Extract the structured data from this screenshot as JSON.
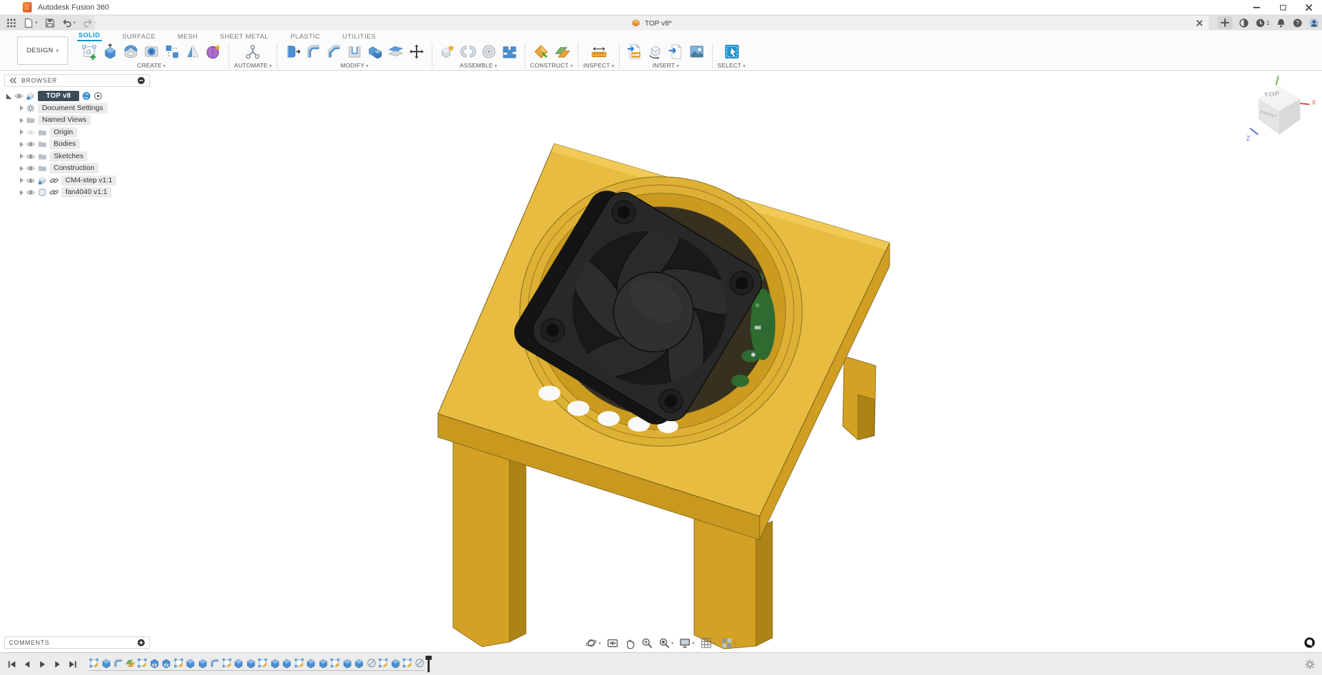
{
  "window": {
    "title": "Autodesk Fusion 360"
  },
  "qat": {
    "items": [
      {
        "name": "app-grid",
        "caret": false
      },
      {
        "name": "file-menu",
        "caret": true
      },
      {
        "name": "save",
        "caret": false
      },
      {
        "name": "undo",
        "caret": true
      },
      {
        "name": "redo",
        "caret": true,
        "disabled": true
      }
    ]
  },
  "tabstrip": {
    "active_tab": {
      "label": "TOP v8*"
    },
    "job_count": "1",
    "right_icons": [
      "extensions",
      "job-status",
      "notifications",
      "help",
      "profile"
    ]
  },
  "ribbon": {
    "design_label": "DESIGN",
    "active_tab": "SOLID",
    "tabs": [
      "SOLID",
      "SURFACE",
      "MESH",
      "SHEET METAL",
      "PLASTIC",
      "UTILITIES"
    ],
    "groups": [
      {
        "label": "CREATE",
        "icons": [
          "create-sketch",
          "extrude",
          "revolve",
          "hole",
          "pattern",
          "mirror",
          "form"
        ]
      },
      {
        "label": "AUTOMATE",
        "icons": [
          "automate"
        ]
      },
      {
        "label": "MODIFY",
        "icons": [
          "press-pull",
          "fillet",
          "chamfer",
          "shell",
          "combine",
          "split",
          "move"
        ]
      },
      {
        "label": "ASSEMBLE",
        "icons": [
          "new-component",
          "joint",
          "as-built-joint",
          "rigid-group"
        ]
      },
      {
        "label": "CONSTRUCT",
        "icons": [
          "plane",
          "offset-plane"
        ]
      },
      {
        "label": "INSPECT",
        "icons": [
          "measure"
        ]
      },
      {
        "label": "INSERT",
        "icons": [
          "insert-svg",
          "insert-mesh",
          "derive",
          "canvas"
        ]
      },
      {
        "label": "SELECT",
        "icons": [
          "select"
        ]
      }
    ]
  },
  "browser": {
    "header": "BROWSER",
    "root": {
      "label": "TOP v8"
    },
    "items": [
      {
        "label": "Document Settings",
        "icon": "gear",
        "eye": "none",
        "link": false
      },
      {
        "label": "Named Views",
        "icon": "folder",
        "eye": "none",
        "link": false
      },
      {
        "label": "Origin",
        "icon": "folder",
        "eye": "off",
        "link": false
      },
      {
        "label": "Bodies",
        "icon": "folder",
        "eye": "on",
        "link": false
      },
      {
        "label": "Sketches",
        "icon": "folder",
        "eye": "on",
        "link": false
      },
      {
        "label": "Construction",
        "icon": "folder",
        "eye": "on",
        "link": false
      },
      {
        "label": "CM4-step v1:1",
        "icon": "component",
        "eye": "on",
        "link": true
      },
      {
        "label": "fan4040 v1:1",
        "icon": "body",
        "eye": "on",
        "link": true
      }
    ]
  },
  "viewcube": {
    "top": "TOP",
    "front": "FRONT",
    "axis_x": "X",
    "axis_z": "Z"
  },
  "navbar": {
    "items": [
      {
        "name": "orbit",
        "caret": true
      },
      {
        "name": "look-at",
        "caret": false
      },
      {
        "name": "pan",
        "caret": false
      },
      {
        "name": "zoom",
        "caret": false
      },
      {
        "name": "fit",
        "caret": true
      },
      {
        "name": "display-settings",
        "caret": true
      },
      {
        "name": "grid-settings",
        "caret": true
      },
      {
        "name": "viewports",
        "caret": true
      }
    ]
  },
  "comments": {
    "header": "COMMENTS"
  },
  "timeline": {
    "playback": [
      "go-to-start",
      "step-back",
      "play",
      "step-forward",
      "go-to-end"
    ],
    "items": [
      "sketch",
      "extrude",
      "fillet",
      "plane",
      "sketch",
      "hole",
      "hole",
      "sketch",
      "extrude",
      "extrude",
      "fillet",
      "sketch",
      "extrude",
      "extrude",
      "sketch",
      "extrude",
      "extrude",
      "sketch",
      "extrude",
      "extrude",
      "sketch",
      "extrude",
      "extrude",
      "pattern",
      "sketch",
      "extrude",
      "sketch",
      "pattern"
    ]
  },
  "model": {
    "description": "yellow bracket with circular fan opening, black 4040 fan, green PCB visible through vents",
    "colors": {
      "bracket_top": "#e7bc41",
      "bracket_side": "#c9981e",
      "fan_frame": "#282828",
      "fan_hub": "#303030",
      "pcb": "#2f6b30"
    }
  },
  "colors": {
    "accent": "#0696d7",
    "strip_bg": "#e2e2e2",
    "ribbon_bg": "#fbfbfb",
    "selection_pill": "#3d4b57"
  }
}
